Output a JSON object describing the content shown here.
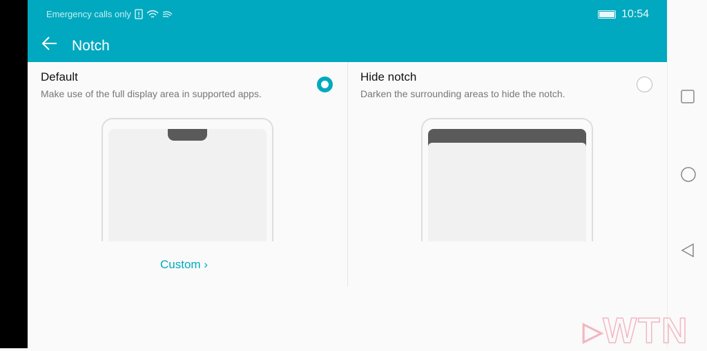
{
  "status_bar": {
    "carrier_text": "Emergency calls only",
    "time": "10:54",
    "icons": [
      "sim-alert-icon",
      "wifi-icon",
      "signal-icon",
      "battery-icon"
    ]
  },
  "header": {
    "title": "Notch",
    "back_icon": "arrow-left-icon"
  },
  "options": [
    {
      "title": "Default",
      "description": "Make use of the full display area in supported apps.",
      "selected": true,
      "link": "Custom"
    },
    {
      "title": "Hide notch",
      "description": "Darken the surrounding areas to hide the notch.",
      "selected": false
    }
  ],
  "nav_bar": {
    "icons": [
      "recents-square-icon",
      "home-circle-icon",
      "back-triangle-icon"
    ]
  },
  "watermark": "WTN",
  "colors": {
    "accent": "#00a9bf",
    "notch": "#5a5a5a"
  }
}
